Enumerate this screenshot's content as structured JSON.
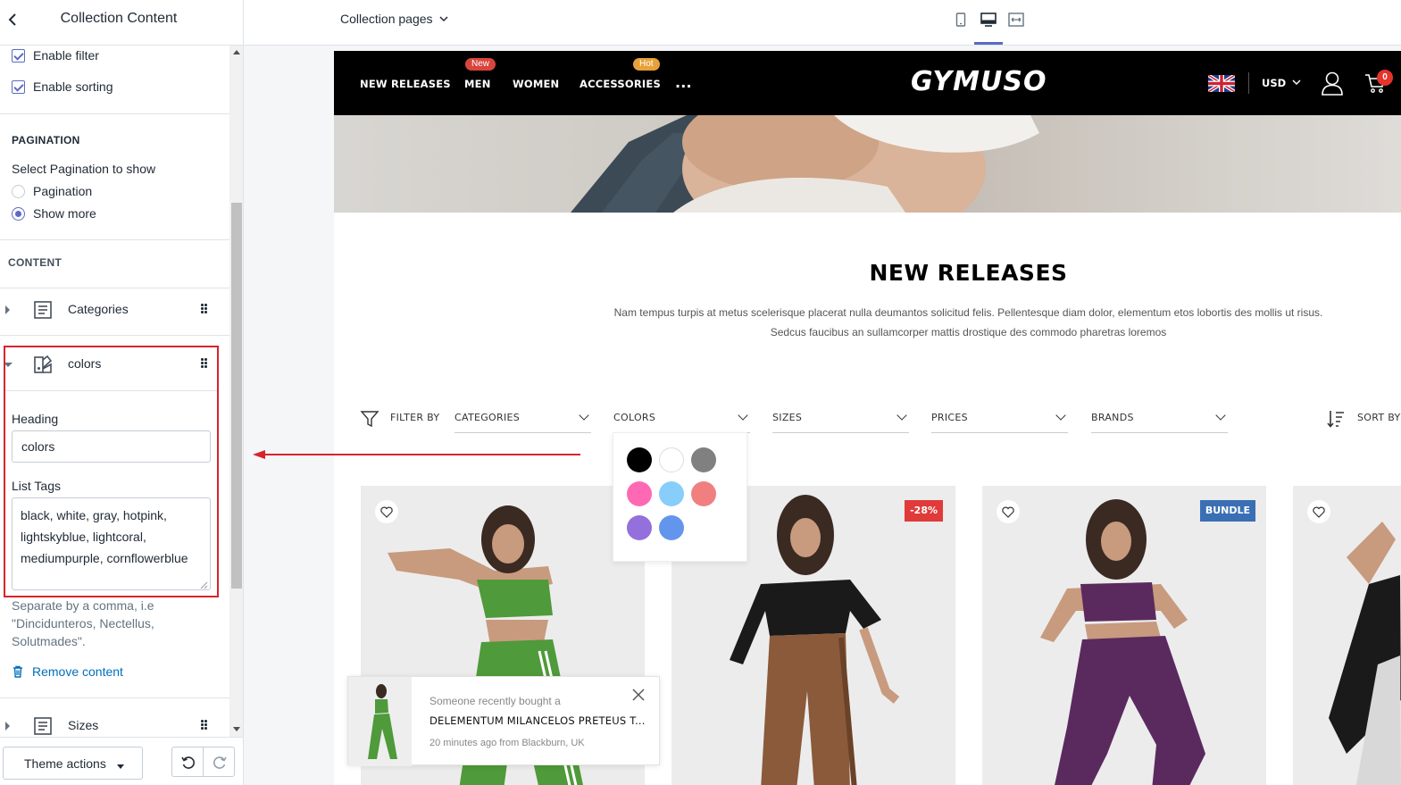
{
  "sidebar": {
    "title": "Collection Content",
    "enable_filter_label": "Enable filter",
    "enable_sorting_label": "Enable sorting",
    "pagination": {
      "heading": "PAGINATION",
      "select_label": "Select Pagination to show",
      "options": [
        "Pagination",
        "Show more"
      ],
      "selected": "Show more"
    },
    "content_heading": "CONTENT",
    "blocks": [
      {
        "label": "Categories",
        "icon": "text-block-icon",
        "expanded": false
      },
      {
        "label": "colors",
        "icon": "color-block-icon",
        "expanded": true
      },
      {
        "label": "Sizes",
        "icon": "text-block-icon",
        "expanded": false
      }
    ],
    "colors_block": {
      "heading_label": "Heading",
      "heading_value": "colors",
      "list_tags_label": "List Tags",
      "list_tags_value": "black, white, gray, hotpink, lightskyblue, lightcoral, mediumpurple, cornflowerblue",
      "help_text": "Separate by a comma, i.e \"Dincidunteros, Nectellus, Solutmades\".",
      "remove_label": "Remove content"
    },
    "footer": {
      "theme_actions_label": "Theme actions"
    }
  },
  "topbar": {
    "page_select": "Collection pages",
    "devices": [
      "mobile-icon",
      "desktop-icon",
      "fullwidth-icon"
    ],
    "active_device": "desktop-icon"
  },
  "store": {
    "nav": [
      {
        "label": "NEW RELEASES",
        "badge": ""
      },
      {
        "label": "MEN",
        "badge": "New",
        "badge_color": "#d9453d"
      },
      {
        "label": "WOMEN",
        "badge": ""
      },
      {
        "label": "ACCESSORIES",
        "badge": "Hot",
        "badge_color": "#e8a13a"
      },
      {
        "label": "...",
        "badge": ""
      }
    ],
    "logo": "GYMUSO",
    "currency": "USD",
    "cart_count": "0",
    "collection_title": "NEW RELEASES",
    "description_line1": "Nam tempus turpis at metus scelerisque placerat nulla deumantos solicitud felis. Pellentesque diam dolor, elementum etos lobortis des mollis ut risus.",
    "description_line2": "Sedcus faucibus an sullamcorper mattis drostique des commodo pharetras loremos",
    "filter_by_label": "FILTER BY",
    "filters": [
      "CATEGORIES",
      "COLORS",
      "SIZES",
      "PRICES",
      "BRANDS"
    ],
    "sort_by_label": "SORT BY",
    "color_swatches": [
      "#000000",
      "#ffffff",
      "#808080",
      "#ff69b4",
      "#87cefa",
      "#f08080",
      "#9370db",
      "#6495ed"
    ],
    "product_tags": [
      "",
      "-28%",
      "BUNDLE",
      ""
    ],
    "tag_colors": {
      "sale": "#e03a3a",
      "bundle": "#3a6fb4"
    },
    "toast": {
      "line1": "Someone recently bought a",
      "line2": "DELEMENTUM MILANCELOS PRETEUS T...",
      "line3": "20 minutes ago from Blackburn, UK"
    }
  },
  "colors": {
    "accent": "#5c6ac4",
    "highlight": "#d9232b",
    "link": "#006fbb"
  }
}
